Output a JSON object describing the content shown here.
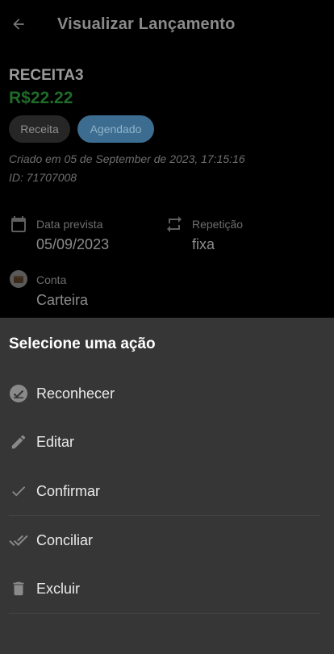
{
  "appbar": {
    "back_icon": "arrow-left-icon",
    "title": "Visualizar Lançamento"
  },
  "transaction": {
    "name": "RECEITA3",
    "amount": "R$22.22",
    "amount_color": "#1f6b2a",
    "chips": [
      "Receita",
      "Agendado"
    ],
    "created": "Criado em 05 de September de 2023, 17:15:16",
    "id": "ID: 71707008"
  },
  "fields": {
    "due_date": {
      "icon": "calendar-icon",
      "label": "Data prevista",
      "value": "05/09/2023"
    },
    "repeat": {
      "icon": "repeat-icon",
      "label": "Repetição",
      "value": "fixa"
    },
    "account": {
      "icon": "wallet-icon",
      "label": "Conta",
      "value": "Carteira"
    }
  },
  "sheet": {
    "title": "Selecione uma ação",
    "actions": [
      {
        "label": "Reconhecer",
        "icon": "badge-check-icon"
      },
      {
        "label": "Editar",
        "icon": "pencil-icon"
      },
      {
        "label": "Confirmar",
        "icon": "check-icon"
      },
      {
        "label": "Conciliar",
        "icon": "double-check-icon"
      },
      {
        "label": "Excluir",
        "icon": "trash-icon"
      }
    ]
  }
}
